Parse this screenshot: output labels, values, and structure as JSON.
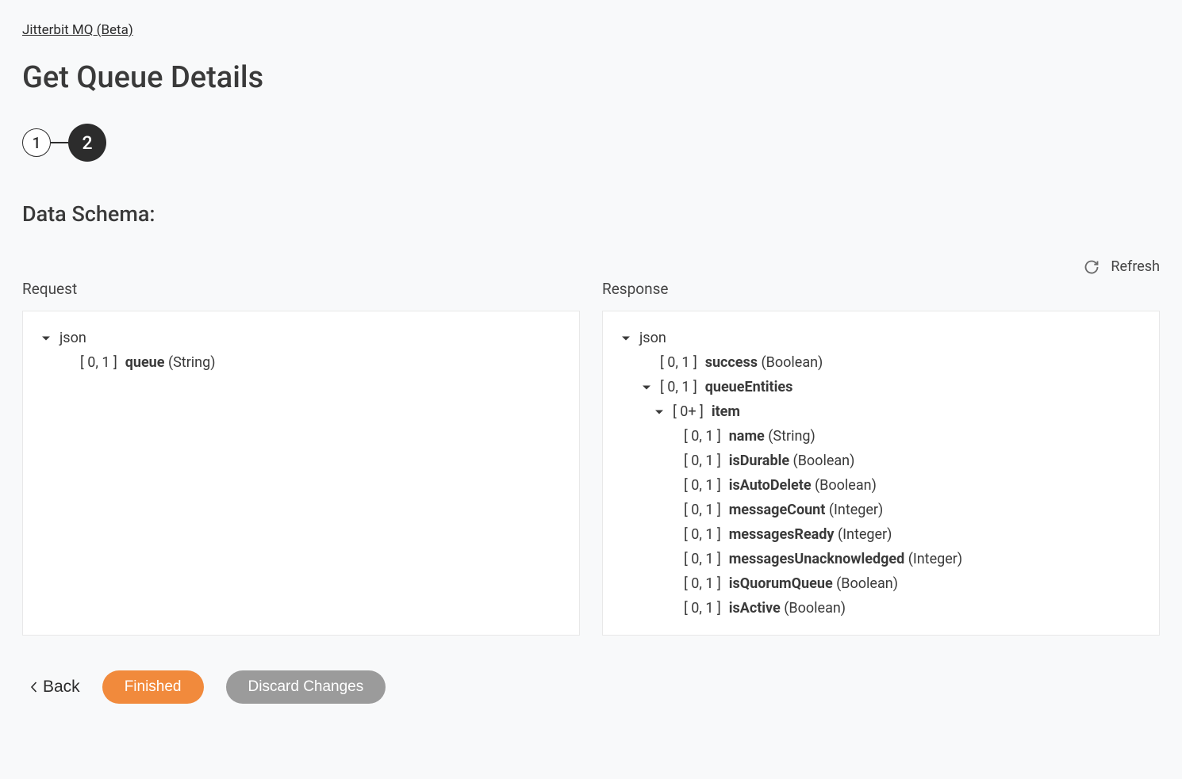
{
  "breadcrumb": "Jitterbit MQ (Beta)",
  "page_title": "Get Queue Details",
  "stepper": {
    "step1": "1",
    "step2": "2"
  },
  "section_title": "Data Schema:",
  "refresh_label": "Refresh",
  "request": {
    "label": "Request",
    "root": "json",
    "fields": {
      "queue": {
        "bracket": "[ 0, 1 ]",
        "name": "queue",
        "type": "(String)"
      }
    }
  },
  "response": {
    "label": "Response",
    "root": "json",
    "success": {
      "bracket": "[ 0, 1 ]",
      "name": "success",
      "type": "(Boolean)"
    },
    "queueEntities": {
      "bracket": "[ 0, 1 ]",
      "name": "queueEntities"
    },
    "item": {
      "bracket": "[ 0+ ]",
      "name": "item"
    },
    "itemFields": {
      "name": {
        "bracket": "[ 0, 1 ]",
        "name": "name",
        "type": "(String)"
      },
      "isDurable": {
        "bracket": "[ 0, 1 ]",
        "name": "isDurable",
        "type": "(Boolean)"
      },
      "isAutoDelete": {
        "bracket": "[ 0, 1 ]",
        "name": "isAutoDelete",
        "type": "(Boolean)"
      },
      "messageCount": {
        "bracket": "[ 0, 1 ]",
        "name": "messageCount",
        "type": "(Integer)"
      },
      "messagesReady": {
        "bracket": "[ 0, 1 ]",
        "name": "messagesReady",
        "type": "(Integer)"
      },
      "messagesUnacknowledged": {
        "bracket": "[ 0, 1 ]",
        "name": "messagesUnacknowledged",
        "type": "(Integer)"
      },
      "isQuorumQueue": {
        "bracket": "[ 0, 1 ]",
        "name": "isQuorumQueue",
        "type": "(Boolean)"
      },
      "isActive": {
        "bracket": "[ 0, 1 ]",
        "name": "isActive",
        "type": "(Boolean)"
      }
    }
  },
  "buttons": {
    "back": "Back",
    "finished": "Finished",
    "discard": "Discard Changes"
  }
}
